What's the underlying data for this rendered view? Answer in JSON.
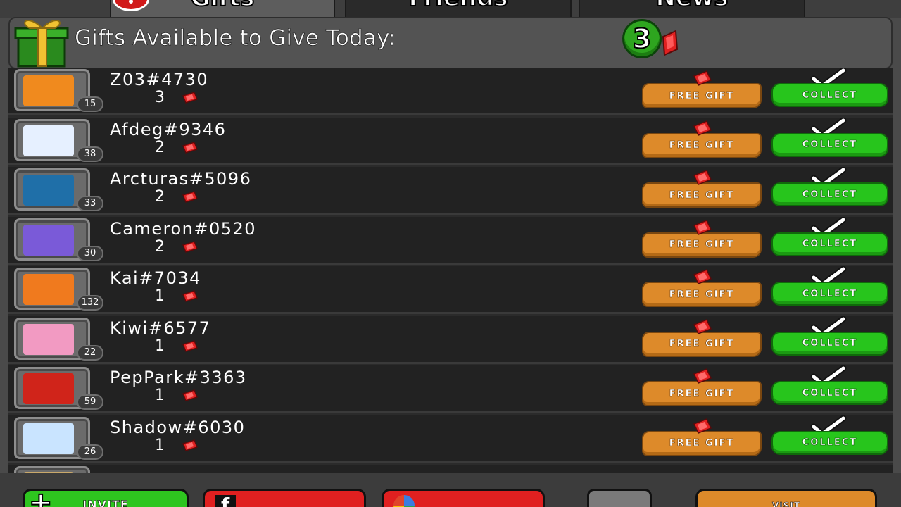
{
  "tabs": [
    {
      "label": "Gifts",
      "active": true
    },
    {
      "label": "Friends",
      "active": false
    },
    {
      "label": "News",
      "active": false
    }
  ],
  "header": {
    "title": "Gifts Available to Give Today:",
    "count": "3",
    "gift_icon": "gift-box-icon",
    "gem_icon": "red-gem-icon"
  },
  "friends": [
    {
      "name": "Z03#4730",
      "level": "15",
      "gifts": "3",
      "avatar": "orange-tent-avatar",
      "free_label": "FREE GIFT",
      "collect_label": "COLLECT"
    },
    {
      "name": "Afdeg#9346",
      "level": "38",
      "gifts": "2",
      "avatar": "white-dragon-avatar",
      "free_label": "FREE GIFT",
      "collect_label": "COLLECT"
    },
    {
      "name": "Arcturas#5096",
      "level": "33",
      "gifts": "2",
      "avatar": "blue-dragon-avatar",
      "free_label": "FREE GIFT",
      "collect_label": "COLLECT"
    },
    {
      "name": "Cameron#0520",
      "level": "30",
      "gifts": "2",
      "avatar": "purple-dragon-avatar",
      "free_label": "FREE GIFT",
      "collect_label": "COLLECT"
    },
    {
      "name": "Kai#7034",
      "level": "132",
      "gifts": "1",
      "avatar": "pumpkin-avatar",
      "free_label": "FREE GIFT",
      "collect_label": "COLLECT"
    },
    {
      "name": "Kiwi#6577",
      "level": "22",
      "gifts": "1",
      "avatar": "pink-dragon-avatar",
      "free_label": "FREE GIFT",
      "collect_label": "COLLECT"
    },
    {
      "name": "PepPark#3363",
      "level": "59",
      "gifts": "1",
      "avatar": "red-dragon-avatar",
      "free_label": "FREE GIFT",
      "collect_label": "COLLECT"
    },
    {
      "name": "Shadow#6030",
      "level": "26",
      "gifts": "1",
      "avatar": "ice-dragon-avatar",
      "free_label": "FREE GIFT",
      "collect_label": "COLLECT"
    },
    {
      "name": "",
      "level": "",
      "gifts": "",
      "avatar": "partial-avatar",
      "free_label": "",
      "collect_label": ""
    }
  ],
  "bottom": {
    "invite_label": "INVITE",
    "visit_label": "VISIT",
    "colors": {
      "green": "#2ec51f",
      "red": "#e02020",
      "orange": "#dd8a2a"
    }
  },
  "colors": {
    "free_gift": "#dd8a2a",
    "collect": "#27c51c",
    "gem": "#d11a1a",
    "row_bg": "#222222"
  }
}
